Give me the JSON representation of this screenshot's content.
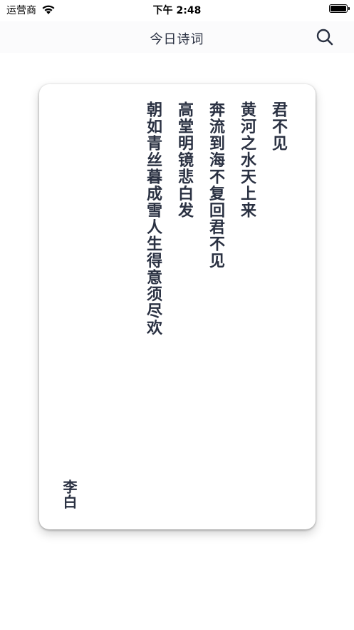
{
  "status_bar": {
    "carrier": "运营商",
    "time": "下午 2:48"
  },
  "nav": {
    "title": "今日诗词",
    "search_icon": "search-icon"
  },
  "poem": {
    "lines": [
      "君不见",
      "黄河之水天上来",
      "奔流到海不复回君不见",
      "高堂明镜悲白发",
      "朝如青丝暮成雪人生得意须尽欢"
    ],
    "author": "李白"
  },
  "colors": {
    "text": "#2a3142",
    "nav_bg": "#fbfbfc",
    "card_bg": "#ffffff"
  }
}
